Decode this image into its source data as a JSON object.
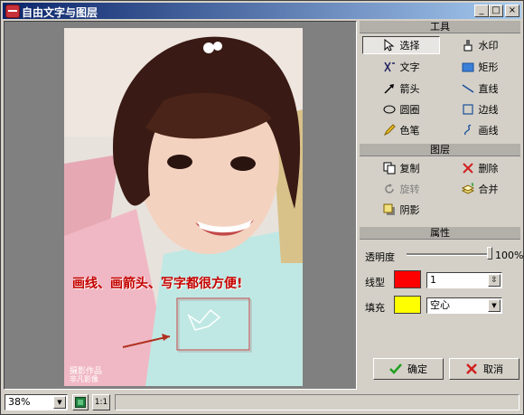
{
  "window": {
    "title": "自由文字与图层"
  },
  "title_buttons": {
    "minimize": "_",
    "maximize": "□",
    "close": "×"
  },
  "tools": {
    "header": "工具",
    "items": [
      {
        "label": "选择",
        "icon": "cursor-arrow-icon"
      },
      {
        "label": "水印",
        "icon": "watermark-stamp-icon"
      },
      {
        "label": "文字",
        "icon": "text-tool-icon"
      },
      {
        "label": "矩形",
        "icon": "rectangle-filled-icon"
      },
      {
        "label": "箭头",
        "icon": "arrow-icon"
      },
      {
        "label": "直线",
        "icon": "line-icon"
      },
      {
        "label": "圆圈",
        "icon": "ellipse-icon"
      },
      {
        "label": "边线",
        "icon": "square-outline-icon"
      },
      {
        "label": "色笔",
        "icon": "pencil-icon"
      },
      {
        "label": "画线",
        "icon": "freehand-line-icon"
      }
    ]
  },
  "layers": {
    "header": "图层",
    "items": [
      {
        "label": "复制",
        "icon": "copy-icon"
      },
      {
        "label": "删除",
        "icon": "delete-x-icon"
      },
      {
        "label": "旋转",
        "icon": "rotate-icon"
      },
      {
        "label": "合并",
        "icon": "merge-icon"
      },
      {
        "label": "阴影",
        "icon": "shadow-icon"
      }
    ]
  },
  "properties": {
    "header": "属性",
    "opacity_label": "透明度",
    "opacity_value": "100%",
    "opacity_fraction": 1.0,
    "line_label": "线型",
    "line_color": "#ff0000",
    "line_width": "1",
    "fill_label": "填充",
    "fill_color": "#ffff00",
    "fill_mode": "空心"
  },
  "actions": {
    "ok": "确定",
    "cancel": "取消"
  },
  "canvas": {
    "caption": "画线、画箭头、写字都很方便!",
    "watermark": "摄影作品",
    "watermark_brand": "非凡影像"
  },
  "status": {
    "zoom": "38%",
    "one_to_one": "1:1"
  }
}
